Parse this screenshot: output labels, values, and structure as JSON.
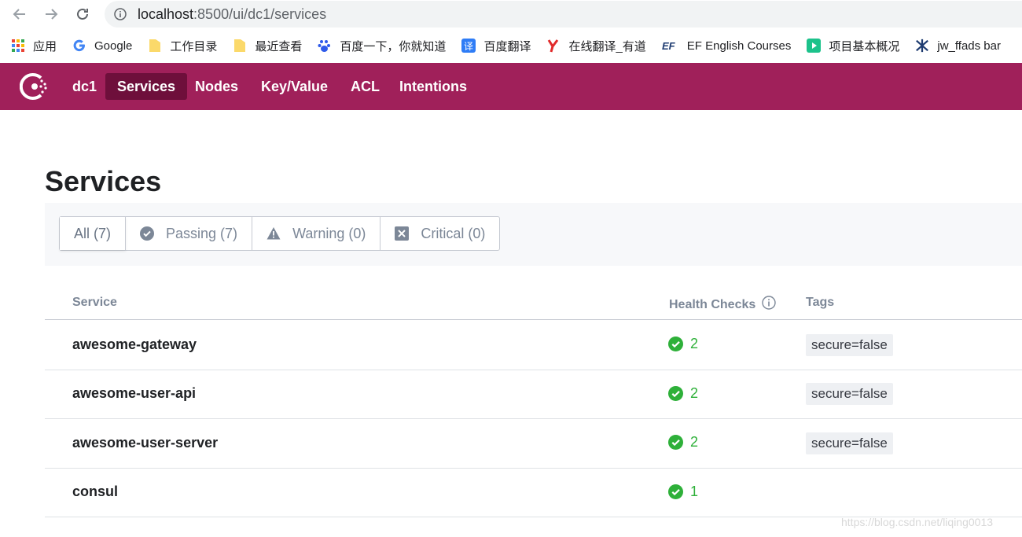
{
  "browser": {
    "url_host": "localhost",
    "url_path": ":8500/ui/dc1/services"
  },
  "bookmarks": [
    {
      "label": "应用",
      "icon": "apps-grid-icon"
    },
    {
      "label": "Google",
      "icon": "google-icon"
    },
    {
      "label": "工作目录",
      "icon": "folder-icon"
    },
    {
      "label": "最近查看",
      "icon": "folder-icon"
    },
    {
      "label": "百度一下，你就知道",
      "icon": "baidu-paw-icon"
    },
    {
      "label": "百度翻译",
      "icon": "baidu-translate-icon"
    },
    {
      "label": "在线翻译_有道",
      "icon": "youdao-icon"
    },
    {
      "label": "EF English Courses",
      "icon": "ef-icon"
    },
    {
      "label": "项目基本概况",
      "icon": "play-icon"
    },
    {
      "label": "jw_ffads bar",
      "icon": "jw-icon"
    }
  ],
  "nav": {
    "datacenter": "dc1",
    "items": [
      "Services",
      "Nodes",
      "Key/Value",
      "ACL",
      "Intentions"
    ],
    "active": "Services"
  },
  "page": {
    "title": "Services",
    "filters": [
      {
        "label": "All (7)",
        "icon": ""
      },
      {
        "label": "Passing (7)",
        "icon": "check-circle-icon"
      },
      {
        "label": "Warning (0)",
        "icon": "warning-triangle-icon"
      },
      {
        "label": "Critical (0)",
        "icon": "x-square-icon"
      }
    ]
  },
  "table": {
    "headers": {
      "service": "Service",
      "health": "Health Checks",
      "tags": "Tags"
    },
    "rows": [
      {
        "name": "awesome-gateway",
        "checks": "2",
        "tag": "secure=false"
      },
      {
        "name": "awesome-user-api",
        "checks": "2",
        "tag": "secure=false"
      },
      {
        "name": "awesome-user-server",
        "checks": "2",
        "tag": "secure=false"
      },
      {
        "name": "consul",
        "checks": "1",
        "tag": ""
      }
    ]
  },
  "watermark": "https://blog.csdn.net/liqing0013",
  "colors": {
    "brand": "#a0205a",
    "brand_dark": "#6e0f3b",
    "passing": "#2eb039"
  }
}
